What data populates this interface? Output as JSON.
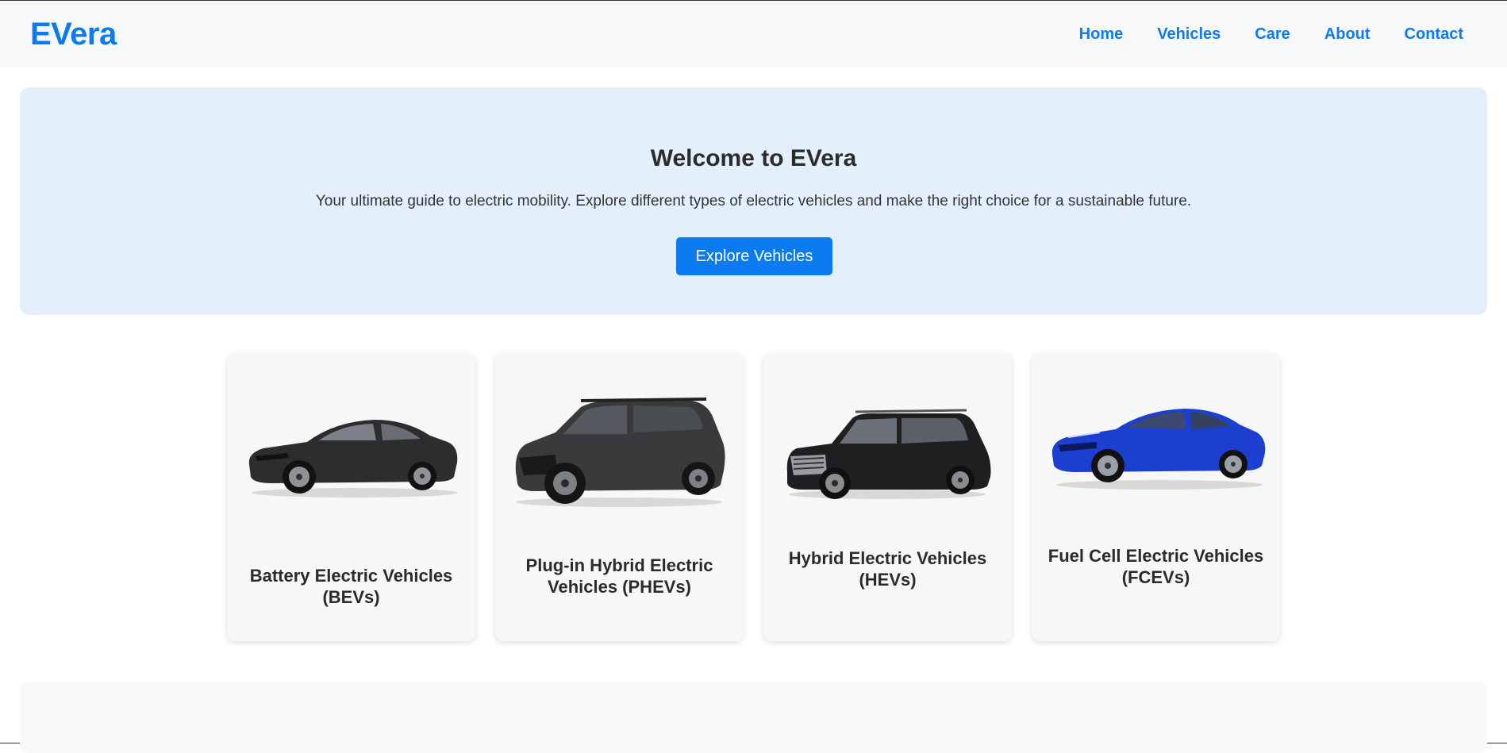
{
  "header": {
    "brand": "EVera",
    "nav": [
      "Home",
      "Vehicles",
      "Care",
      "About",
      "Contact"
    ]
  },
  "hero": {
    "title": "Welcome to EVera",
    "subtitle": "Your ultimate guide to electric mobility. Explore different types of electric vehicles and make the right choice for a sustainable future.",
    "cta_label": "Explore Vehicles"
  },
  "cards": [
    {
      "title": "Battery Electric Vehicles (BEVs)",
      "image": "black-sedan-car-image"
    },
    {
      "title": "Plug-in Hybrid Electric Vehicles (PHEVs)",
      "image": "grey-suv-car-image"
    },
    {
      "title": "Hybrid Electric Vehicles (HEVs)",
      "image": "black-suv-car-image"
    },
    {
      "title": "Fuel Cell Electric Vehicles (FCEVs)",
      "image": "blue-sedan-car-image"
    }
  ],
  "colors": {
    "accent": "#0d7bf0",
    "hero_bg": "#e3f0fb",
    "header_bg": "#f7f8fa",
    "card_bg": "#f7f7f7"
  }
}
